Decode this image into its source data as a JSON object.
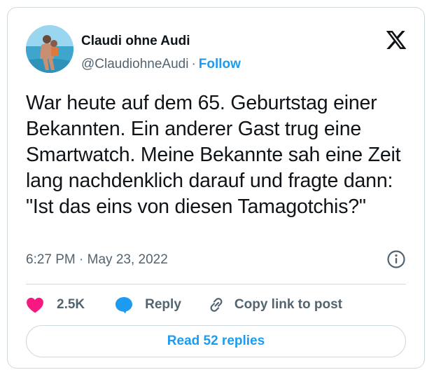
{
  "author": {
    "display_name": "Claudi ohne Audi",
    "handle": "@ClaudiohneAudi",
    "separator": "·",
    "follow_label": "Follow",
    "avatar_icon": "profile-photo"
  },
  "brand": {
    "logo": "x-logo-icon"
  },
  "tweet": {
    "text": "War heute auf dem 65. Geburtstag einer Bekannten. Ein anderer Gast trug eine Smartwatch. Meine Bekannte sah eine Zeit lang nachdenklich darauf und fragte dann: \"Ist das eins von diesen Tamagotchis?\"",
    "timestamp": "6:27 PM · May 23, 2022",
    "info_icon": "info-icon"
  },
  "actions": {
    "like_count": "2.5K",
    "reply_label": "Reply",
    "copy_label": "Copy link to post"
  },
  "replies_button": {
    "label": "Read 52 replies"
  },
  "colors": {
    "text": "#0f1419",
    "secondary": "#536471",
    "accent": "#1d9bf0",
    "like": "#f91880",
    "border": "#cfd9de"
  }
}
